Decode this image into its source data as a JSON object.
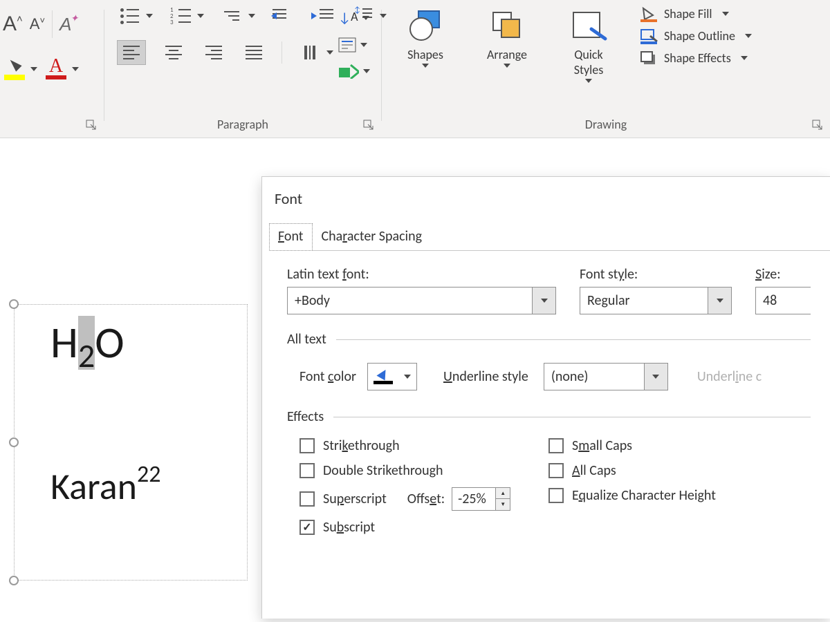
{
  "ribbon": {
    "paragraph_label": "Paragraph",
    "drawing_label": "Drawing",
    "shapes": "Shapes",
    "arrange": "Arrange",
    "quick_styles_l1": "Quick",
    "quick_styles_l2": "Styles",
    "shape_fill": "Shape Fill",
    "shape_outline": "Shape Outline",
    "shape_effects": "Shape Effects"
  },
  "slide": {
    "t1_H": "H",
    "t1_2": "2",
    "t1_O": "O",
    "t2_name": "Karan",
    "t2_sup": "22"
  },
  "dialog": {
    "title": "Font",
    "tab_font_pre": "F",
    "tab_font_rest": "ont",
    "tab_spacing_pre": "Cha",
    "tab_spacing_u": "r",
    "tab_spacing_rest": "acter Spacing",
    "latin_font_label_pre": "Latin text ",
    "latin_font_label_u": "f",
    "latin_font_label_post": "ont:",
    "latin_font_value": "+Body",
    "font_style_label_pre": "Font st",
    "font_style_label_u": "y",
    "font_style_label_post": "le:",
    "font_style_value": "Regular",
    "size_label_u": "S",
    "size_label_post": "ize:",
    "size_value": "48",
    "all_text": "All text",
    "font_color_label_pre": "Font ",
    "font_color_label_u": "c",
    "font_color_label_post": "olor",
    "underline_style_label_u": "U",
    "underline_style_label_post": "nderline style",
    "underline_style_value": "(none)",
    "underline_color_grey_pre": "Underl",
    "underline_color_grey_u": "i",
    "underline_color_grey_post": "ne c",
    "effects_label": "Effects",
    "strike_pre": "Stri",
    "strike_u": "k",
    "strike_post": "ethrough",
    "dstrike": "Double Strikethrough",
    "superscript_pre": "Su",
    "superscript_u": "p",
    "superscript_post": "erscript",
    "subscript_pre": "Su",
    "subscript_u": "b",
    "subscript_post": "script",
    "offset_pre": "Offs",
    "offset_u": "e",
    "offset_post": "t:",
    "offset_value": "-25%",
    "small_caps_pre": "S",
    "small_caps_u": "m",
    "small_caps_post": "all Caps",
    "all_caps_u": "A",
    "all_caps_post": "ll Caps",
    "eq_height_pre": "E",
    "eq_height_u": "q",
    "eq_height_post": "ualize Character Height"
  }
}
